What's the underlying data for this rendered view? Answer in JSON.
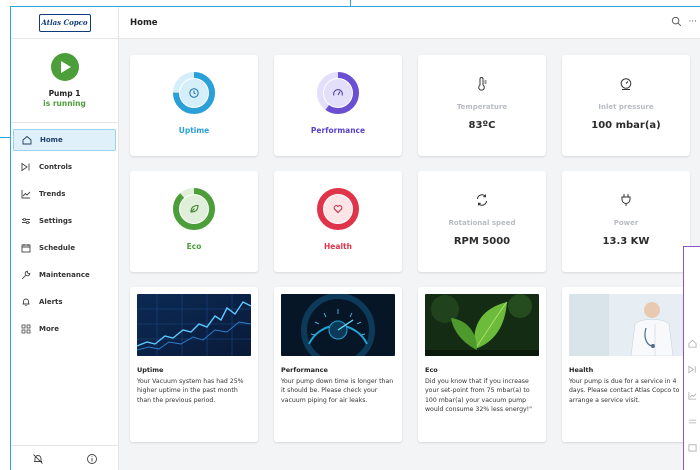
{
  "sidebar": {
    "logo": "Atlas Copco",
    "pump_name": "Pump 1",
    "pump_status": "is running",
    "items": [
      {
        "label": "Home",
        "icon": "home-icon",
        "active": true
      },
      {
        "label": "Controls",
        "icon": "controls-icon"
      },
      {
        "label": "Trends",
        "icon": "trends-icon"
      },
      {
        "label": "Settings",
        "icon": "settings-icon"
      },
      {
        "label": "Schedule",
        "icon": "schedule-icon"
      },
      {
        "label": "Maintenance",
        "icon": "wrench-icon"
      },
      {
        "label": "Alerts",
        "icon": "bell-icon"
      },
      {
        "label": "More",
        "icon": "grid-icon"
      }
    ]
  },
  "header": {
    "title": "Home",
    "more": "···"
  },
  "metrics": {
    "uptime": {
      "label": "Uptime",
      "color": "#2a9fd8"
    },
    "performance": {
      "label": "Performance",
      "color": "#6a4fd3"
    },
    "temperature": {
      "label": "Temperature",
      "value": "83ºC"
    },
    "inlet_pressure": {
      "label": "Inlet pressure",
      "value": "100 mbar(a)"
    },
    "eco": {
      "label": "Eco",
      "color": "#4c9e3a"
    },
    "health": {
      "label": "Health",
      "color": "#e0344a"
    },
    "rotational_speed": {
      "label": "Rotational speed",
      "value": "RPM 5000"
    },
    "power": {
      "label": "Power",
      "value": "13.3 KW"
    }
  },
  "info_cards": [
    {
      "title": "Uptime",
      "text": "Your Vacuum system has had 25% higher uptime in the past month than the previous period."
    },
    {
      "title": "Performance",
      "text": "Your pump down time is longer than it should be. Please check your vacuum piping for air leaks."
    },
    {
      "title": "Eco",
      "text": "Did you know that if you increase your set-point from 75 mbar(a) to 100 mbar(a) your vacuum pump would consume 32% less energy!\""
    },
    {
      "title": "Health",
      "text": "Your pump is due for a service in 4 days. Please contact Atlas Copco to arrange a service visit."
    }
  ]
}
